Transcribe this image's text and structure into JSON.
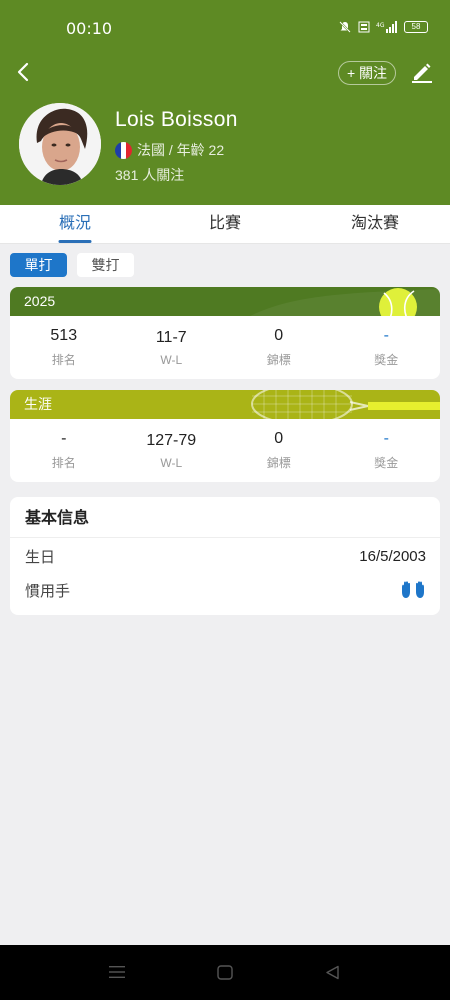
{
  "status_bar": {
    "time": "00:10",
    "battery": "58"
  },
  "header": {
    "follow_label": "+ 關注",
    "player_name": "Lois Boisson",
    "country_age": "法國 / 年齡 22",
    "followers": "381 人關注",
    "flag_colors": [
      "#1e3ea8",
      "#ffffff",
      "#e1252f"
    ],
    "bg_color": "#5e8a24"
  },
  "tabs": [
    {
      "label": "概況",
      "active": true
    },
    {
      "label": "比賽",
      "active": false
    },
    {
      "label": "淘汰賽",
      "active": false
    }
  ],
  "segment": {
    "singles": "單打",
    "doubles": "雙打"
  },
  "season_card": {
    "title": "2025",
    "stats": [
      {
        "value": "513",
        "label": "排名"
      },
      {
        "value": "11-7",
        "label": "W-L"
      },
      {
        "value": "0",
        "label": "錦標"
      },
      {
        "value": "-",
        "label": "獎金"
      }
    ]
  },
  "career_card": {
    "title": "生涯",
    "stats": [
      {
        "value": "-",
        "label": "排名"
      },
      {
        "value": "127-79",
        "label": "W-L"
      },
      {
        "value": "0",
        "label": "錦標"
      },
      {
        "value": "-",
        "label": "獎金"
      }
    ]
  },
  "basic_info": {
    "title": "基本信息",
    "birthday_label": "生日",
    "birthday_value": "16/5/2003",
    "handedness_label": "慣用手",
    "handedness_icon": "hands-icon"
  },
  "colors": {
    "accent_blue": "#1e76c9",
    "season_green": "#4f7a22",
    "career_olive": "#aab417"
  }
}
